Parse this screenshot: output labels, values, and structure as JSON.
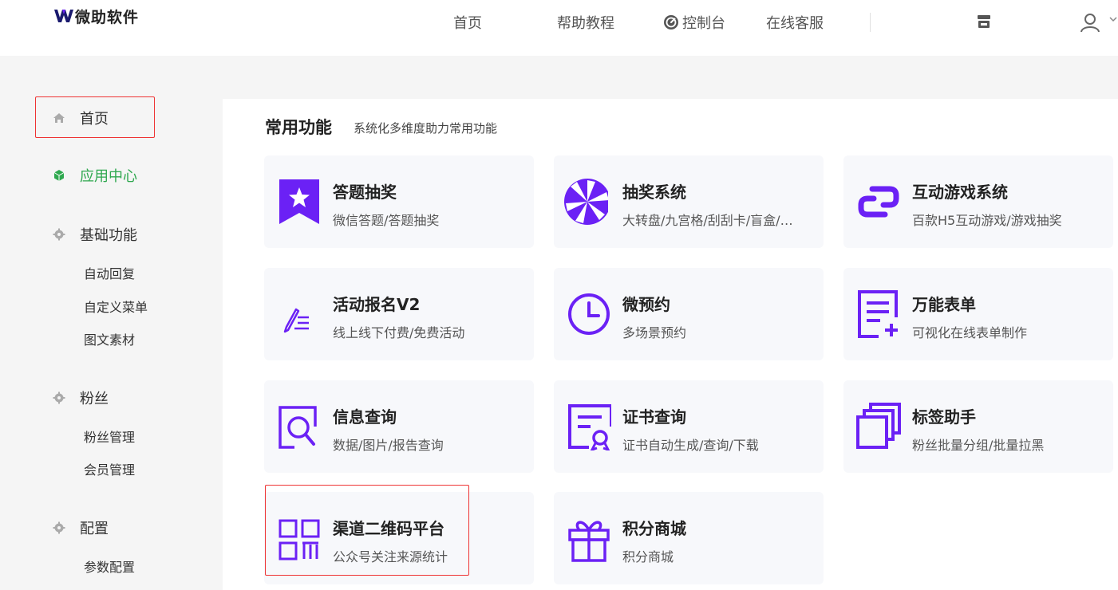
{
  "brand": {
    "name": "微助软件",
    "accent": "#6b21f5"
  },
  "nav": {
    "home": "首页",
    "help": "帮助教程",
    "console": "控制台",
    "support": "在线客服"
  },
  "sidebar": {
    "home": "首页",
    "app_center": "应用中心",
    "basic": "基础功能",
    "basic_items": [
      "自动回复",
      "自定义菜单",
      "图文素材"
    ],
    "fans": "粉丝",
    "fans_items": [
      "粉丝管理",
      "会员管理"
    ],
    "config": "配置",
    "config_items": [
      "参数配置"
    ]
  },
  "section": {
    "title": "常用功能",
    "subtitle": "系统化多维度助力常用功能"
  },
  "cards": [
    {
      "title": "答题抽奖",
      "desc": "微信答题/答题抽奖",
      "icon": "star-flag-icon"
    },
    {
      "title": "抽奖系统",
      "desc": "大转盘/九宫格/刮刮卡/盲盒/…",
      "icon": "wheel-icon"
    },
    {
      "title": "互动游戏系统",
      "desc": "百款H5互动游戏/游戏抽奖",
      "icon": "game-link-icon"
    },
    {
      "title": "活动报名V2",
      "desc": "线上线下付费/免费活动",
      "icon": "pen-list-icon"
    },
    {
      "title": "微预约",
      "desc": "多场景预约",
      "icon": "clock-icon"
    },
    {
      "title": "万能表单",
      "desc": "可视化在线表单制作",
      "icon": "form-add-icon"
    },
    {
      "title": "信息查询",
      "desc": "数据/图片/报告查询",
      "icon": "search-doc-icon"
    },
    {
      "title": "证书查询",
      "desc": "证书自动生成/查询/下载",
      "icon": "certificate-icon"
    },
    {
      "title": "标签助手",
      "desc": "粉丝批量分组/批量拉黑",
      "icon": "stack-icon"
    },
    {
      "title": "渠道二维码平台",
      "desc": "公众号关注来源统计",
      "icon": "qrcode-icon"
    },
    {
      "title": "积分商城",
      "desc": "积分商城",
      "icon": "gift-icon"
    }
  ]
}
